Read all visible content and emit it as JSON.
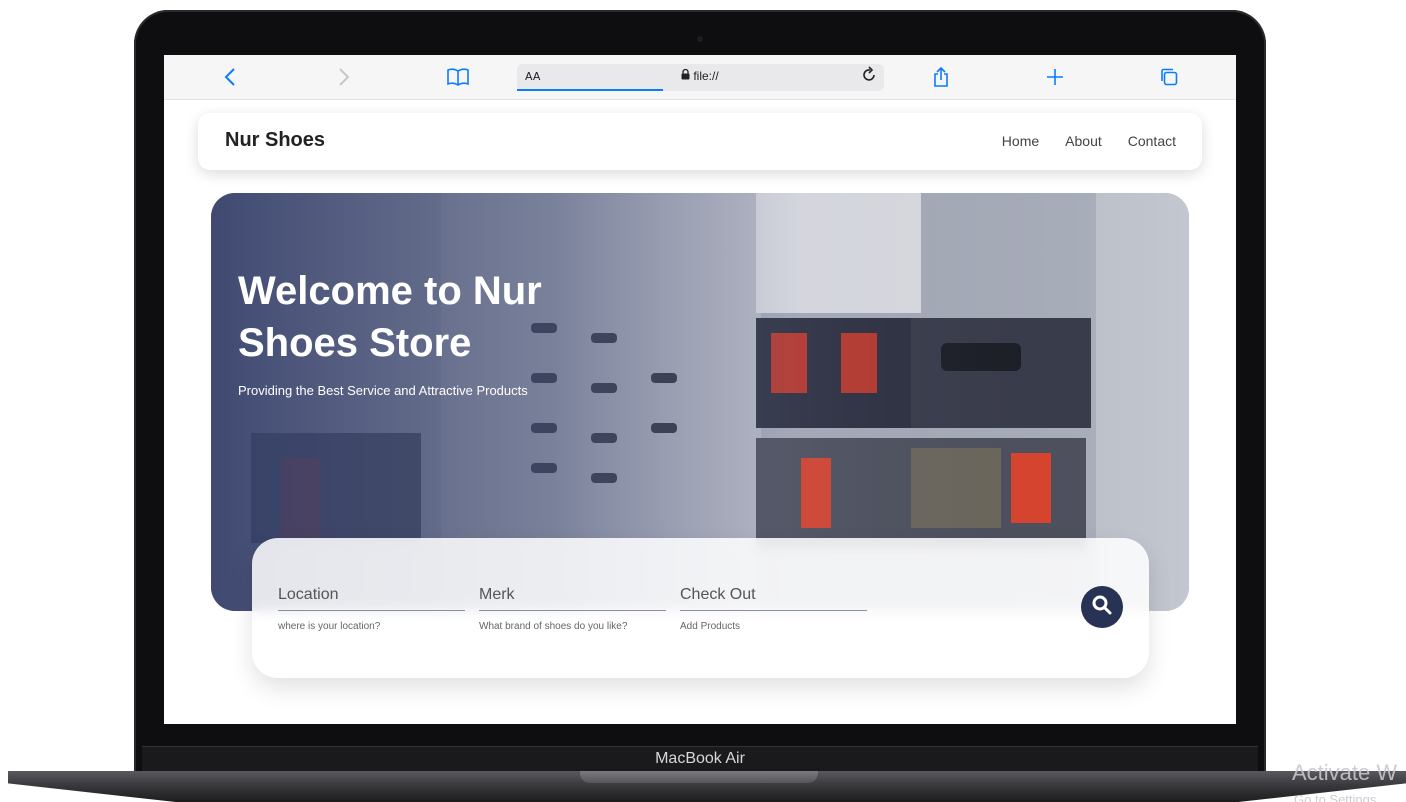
{
  "browser": {
    "reader_label": "AA",
    "address": "file://",
    "icons": {
      "back": "chevron-left-icon",
      "forward": "chevron-right-icon",
      "bookmarks": "book-icon",
      "lock": "lock-icon",
      "reload": "reload-icon",
      "share": "share-icon",
      "new_tab": "plus-icon",
      "tabs": "tabs-icon"
    },
    "accent": "#0a7cff"
  },
  "site": {
    "brand": "Nur Shoes",
    "nav": [
      "Home",
      "About",
      "Contact"
    ]
  },
  "hero": {
    "title": "Welcome to Nur Shoes Store",
    "subtitle": "Providing the Best Service and Attractive Products"
  },
  "search_form": {
    "fields": [
      {
        "label": "Location",
        "hint": "where is your location?"
      },
      {
        "label": "Merk",
        "hint": "What brand of shoes do you like?"
      },
      {
        "label": "Check Out",
        "hint": "Add Products"
      }
    ],
    "button_icon": "search-icon",
    "button_color": "#283255"
  },
  "device": {
    "label": "MacBook Air"
  },
  "os_watermark": {
    "line1": "Activate W",
    "line2": "Go to Settings"
  }
}
